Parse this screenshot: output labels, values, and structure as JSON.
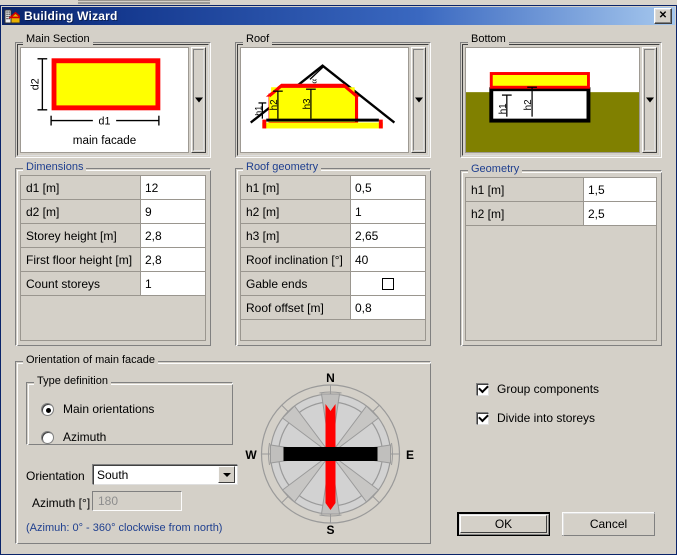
{
  "window": {
    "title": "Building Wizard",
    "icon": "building-wizard-icon",
    "close_label": "✕"
  },
  "main_section": {
    "group_label": "Main Section",
    "diagram": {
      "dim_height_label": "d2",
      "dim_width_label": "d1",
      "caption": "main facade",
      "fill_color": "#ffff00",
      "outline_color": "#ff0000"
    },
    "scroll_arrow": "chevron-down-icon",
    "table_label": "Dimensions",
    "rows": [
      {
        "label": "d1  [m]",
        "value": "12"
      },
      {
        "label": "d2  [m]",
        "value": "9"
      },
      {
        "label": "Storey height  [m]",
        "value": "2,8"
      },
      {
        "label": "First floor height  [m]",
        "value": "2,8"
      },
      {
        "label": "Count storeys",
        "value": "1"
      }
    ]
  },
  "roof_section": {
    "group_label": "Roof",
    "diagram": {
      "angle_label": "α",
      "h1_label": "h1",
      "h2_label": "h2",
      "h3_label": "h3",
      "fill_color": "#ffff00",
      "outline_color": "#ff0000"
    },
    "scroll_arrow": "chevron-down-icon",
    "table_label": "Roof geometry",
    "rows": [
      {
        "label": "h1  [m]",
        "value": "0,5",
        "type": "text"
      },
      {
        "label": "h2  [m]",
        "value": "1",
        "type": "text"
      },
      {
        "label": "h3  [m]",
        "value": "2,65",
        "type": "text"
      },
      {
        "label": "Roof inclination  [°]",
        "value": "40",
        "type": "text"
      },
      {
        "label": "Gable ends",
        "value": "",
        "type": "checkbox",
        "checked": false
      },
      {
        "label": "Roof offset  [m]",
        "value": "0,8",
        "type": "text"
      }
    ]
  },
  "bottom_section": {
    "group_label": "Bottom",
    "diagram": {
      "h1_label": "h1",
      "h2_label": "h2",
      "ground_color": "#808000",
      "fill_color": "#ffff00",
      "outline_color": "#ff0000"
    },
    "scroll_arrow": "chevron-down-icon",
    "table_label": "Geometry",
    "rows": [
      {
        "label": "h1  [m]",
        "value": "1,5"
      },
      {
        "label": "h2  [m]",
        "value": "2,5"
      }
    ]
  },
  "orientation": {
    "group_label": "Orientation of main facade",
    "type_definition": {
      "group_label": "Type definition",
      "options": [
        {
          "label": "Main orientations",
          "selected": true
        },
        {
          "label": "Azimuth",
          "selected": false
        }
      ]
    },
    "orientation_field": {
      "label": "Orientation",
      "value": "South",
      "dropdown_icon": "chevron-down-icon"
    },
    "azimuth_field": {
      "label": "Azimuth [°]",
      "value": "180",
      "disabled": true
    },
    "hint": "(Azimuh: 0° - 360° clockwise from north)",
    "compass": {
      "north": "N",
      "east": "E",
      "south": "S",
      "west": "W",
      "needle_color": "#ff0000",
      "facade_color": "#000000"
    }
  },
  "options": {
    "checkboxes": [
      {
        "label": "Group components",
        "checked": true
      },
      {
        "label": "Divide into storeys",
        "checked": true
      }
    ]
  },
  "actions": {
    "ok_label": "OK",
    "cancel_label": "Cancel"
  }
}
